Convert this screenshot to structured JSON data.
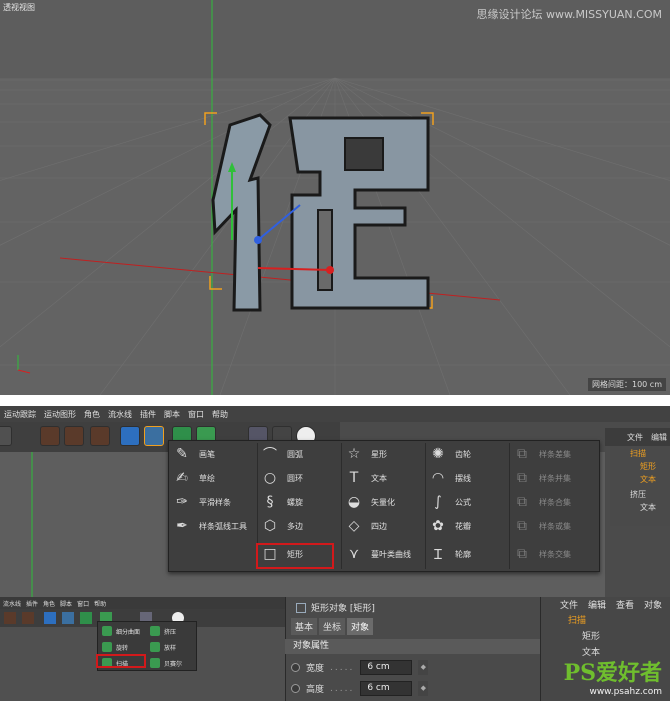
{
  "viewport": {
    "title": "透视视图",
    "watermark": "思缘设计论坛 www.MISSYUAN.COM",
    "grid_info": "网格间距：100 cm",
    "glyph": "促"
  },
  "menubar": [
    "运动跟踪",
    "运动图形",
    "角色",
    "流水线",
    "插件",
    "脚本",
    "窗口",
    "帮助"
  ],
  "menubar_left": "",
  "right_panel": {
    "tabs": [
      "文件",
      "编辑"
    ],
    "tree": [
      {
        "label": "扫描",
        "color": "orange"
      },
      {
        "label": "矩形",
        "color": "orange"
      },
      {
        "label": "文本",
        "color": "orange"
      },
      {
        "label": "挤压",
        "color": "normal"
      },
      {
        "label": "文本",
        "color": "normal"
      }
    ]
  },
  "popup": {
    "col1": [
      "画笔",
      "草绘",
      "平滑样条",
      "样条弧线工具"
    ],
    "col2": [
      "圆弧",
      "圆环",
      "螺旋",
      "多边",
      "矩形"
    ],
    "col3": [
      "星形",
      "文本",
      "矢量化",
      "四边",
      "蔓叶类曲线"
    ],
    "col4": [
      "齿轮",
      "摆线",
      "公式",
      "花瓣",
      "轮廓"
    ],
    "col5": [
      "样条差集",
      "样条并集",
      "样条合集",
      "样条或集",
      "样条交集"
    ]
  },
  "mini": {
    "menu": [
      "流水线",
      "插件",
      "角色",
      "脚本",
      "窗口",
      "帮助"
    ],
    "items": [
      "细分曲面",
      "挤压",
      "旋转",
      "放样",
      "扫描",
      "贝赛尔"
    ]
  },
  "attributes": {
    "title": "矩形对象 [矩形]",
    "tabs": [
      "基本",
      "坐标",
      "对象"
    ],
    "active_tab": "对象",
    "section": "对象属性",
    "fields": [
      {
        "label": "宽度",
        "value": "6 cm"
      },
      {
        "label": "高度",
        "value": "6 cm"
      }
    ]
  },
  "object_manager": {
    "tabs": [
      "文件",
      "编辑",
      "查看",
      "对象"
    ],
    "rows": [
      {
        "label": "扫描",
        "color": "orange"
      },
      {
        "label": "矩形",
        "color": "normal"
      },
      {
        "label": "文本",
        "color": "normal"
      },
      {
        "label": "",
        "color": "normal"
      }
    ]
  },
  "ps_logo": {
    "big": "PS爱好者",
    "small": "www.psahz.com"
  },
  "colors": {
    "highlight": "#d2191b",
    "orange": "#f0a020",
    "axis_green": "#2fbf3a",
    "axis_red": "#d82020",
    "axis_blue": "#3060e0"
  }
}
